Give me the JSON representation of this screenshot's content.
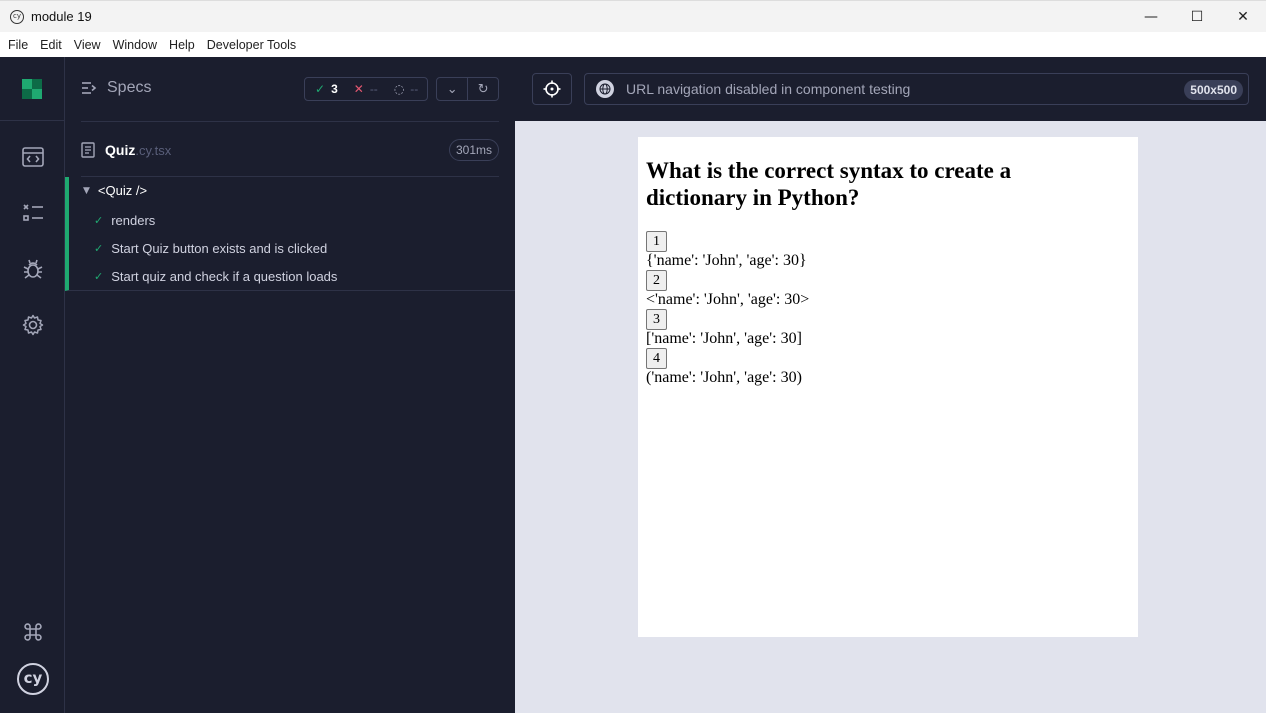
{
  "window": {
    "title": "module 19",
    "app_icon_text": "cy",
    "minimize_icon": "—",
    "maximize_icon": "☐",
    "close_icon": "✕"
  },
  "menu": [
    "File",
    "Edit",
    "View",
    "Window",
    "Help",
    "Developer Tools"
  ],
  "reporter": {
    "specs_label": "Specs",
    "stats": {
      "passed": "3",
      "failed": "--",
      "pending": "--"
    },
    "spec": {
      "name": "Quiz",
      "ext": ".cy.tsx",
      "duration": "301ms"
    },
    "suite": {
      "title": "<Quiz />",
      "tests": [
        "renders",
        "Start Quiz button exists and is clicked",
        "Start quiz and check if a question loads"
      ]
    }
  },
  "aut": {
    "url_text": "URL navigation disabled in component testing",
    "viewport": "500x500",
    "question": "What is the correct syntax to create a dictionary in Python?",
    "answers": [
      {
        "button": "1",
        "text": "{'name': 'John', 'age': 30}"
      },
      {
        "button": "2",
        "text": "<'name': 'John', 'age': 30>"
      },
      {
        "button": "3",
        "text": "['name': 'John', 'age': 30]"
      },
      {
        "button": "4",
        "text": "('name': 'John', 'age': 30)"
      }
    ]
  },
  "colors": {
    "sidebar_bg": "#1b1e2e",
    "pass_green": "#1fa971",
    "fail_red": "#e45770",
    "aut_bg": "#e1e3ed"
  }
}
